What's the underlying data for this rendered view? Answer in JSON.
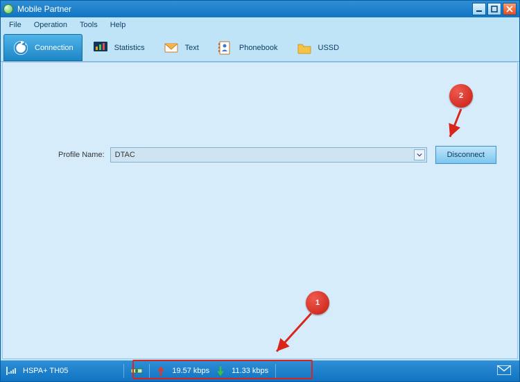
{
  "window": {
    "title": "Mobile Partner"
  },
  "menu": {
    "file": "File",
    "operation": "Operation",
    "tools": "Tools",
    "help": "Help"
  },
  "toolbar": {
    "connection": "Connection",
    "statistics": "Statistics",
    "text": "Text",
    "phonebook": "Phonebook",
    "ussd": "USSD"
  },
  "form": {
    "profile_label": "Profile Name:",
    "profile_value": "DTAC",
    "disconnect": "Disconnect"
  },
  "status": {
    "network": "HSPA+  TH05",
    "upload": "19.57 kbps",
    "download": "11.33 kbps"
  },
  "annotations": {
    "badge1": "1",
    "badge2": "2"
  },
  "icons": {
    "refresh": "refresh",
    "stats": "stats",
    "mail": "mail",
    "contact": "contact",
    "folder": "folder"
  }
}
